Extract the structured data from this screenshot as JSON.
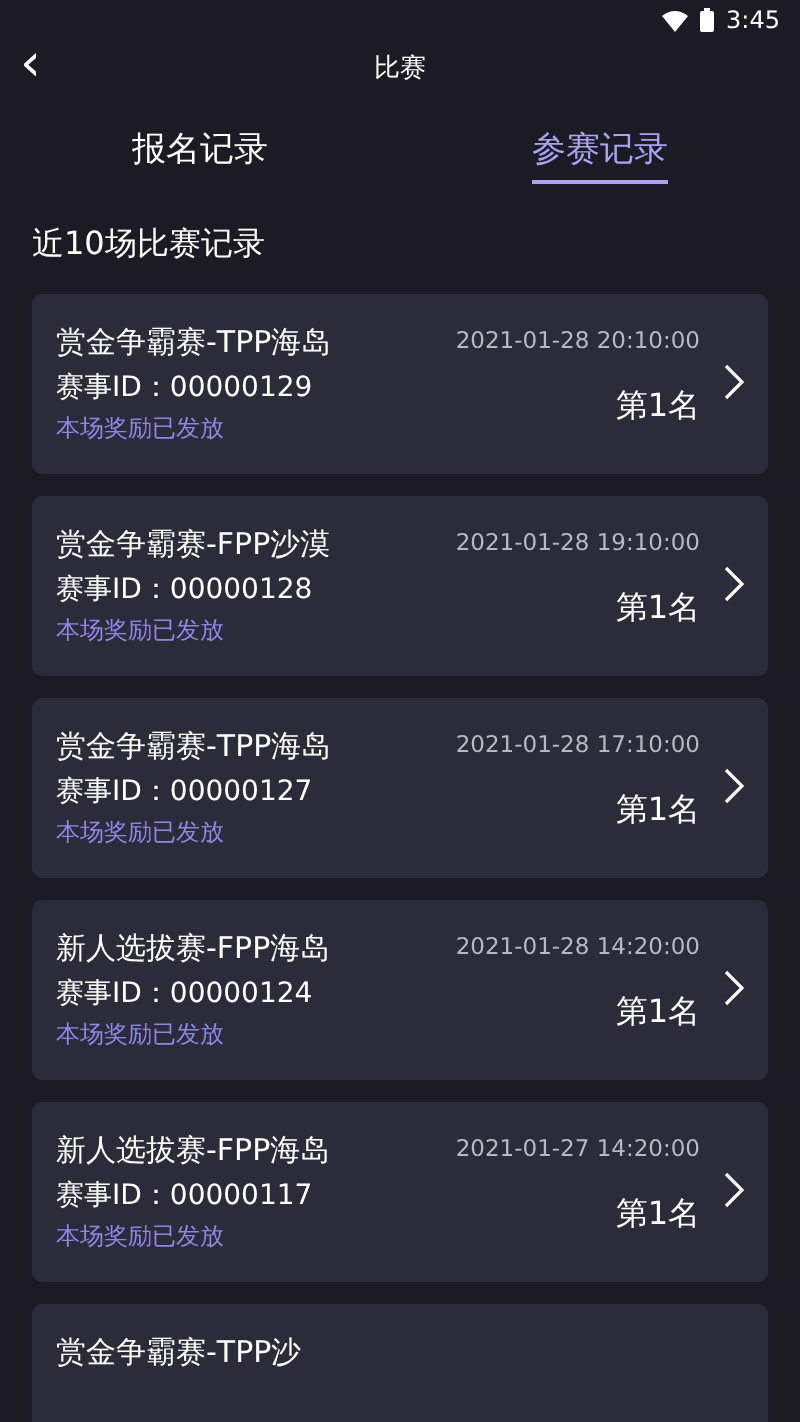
{
  "status_bar": {
    "time": "3:45"
  },
  "header": {
    "title": "比赛",
    "back": "‹"
  },
  "tabs": [
    {
      "label": "报名记录",
      "selected": false
    },
    {
      "label": "参赛记录",
      "selected": true
    }
  ],
  "section_title": "近10场比赛记录",
  "records": [
    {
      "title": "赏金争霸赛-TPP海岛",
      "time": "2021-01-28 20:10:00",
      "match_id": "赛事ID：00000129",
      "reward": "本场奖励已发放",
      "rank": "第1名"
    },
    {
      "title": "赏金争霸赛-FPP沙漠",
      "time": "2021-01-28 19:10:00",
      "match_id": "赛事ID：00000128",
      "reward": "本场奖励已发放",
      "rank": "第1名"
    },
    {
      "title": "赏金争霸赛-TPP海岛",
      "time": "2021-01-28 17:10:00",
      "match_id": "赛事ID：00000127",
      "reward": "本场奖励已发放",
      "rank": "第1名"
    },
    {
      "title": "新人选拔赛-FPP海岛",
      "time": "2021-01-28 14:20:00",
      "match_id": "赛事ID：00000124",
      "reward": "本场奖励已发放",
      "rank": "第1名"
    },
    {
      "title": "新人选拔赛-FPP海岛",
      "time": "2021-01-27 14:20:00",
      "match_id": "赛事ID：00000117",
      "reward": "本场奖励已发放",
      "rank": "第1名"
    },
    {
      "title": "赏金争霸赛-TPP沙"
    }
  ]
}
